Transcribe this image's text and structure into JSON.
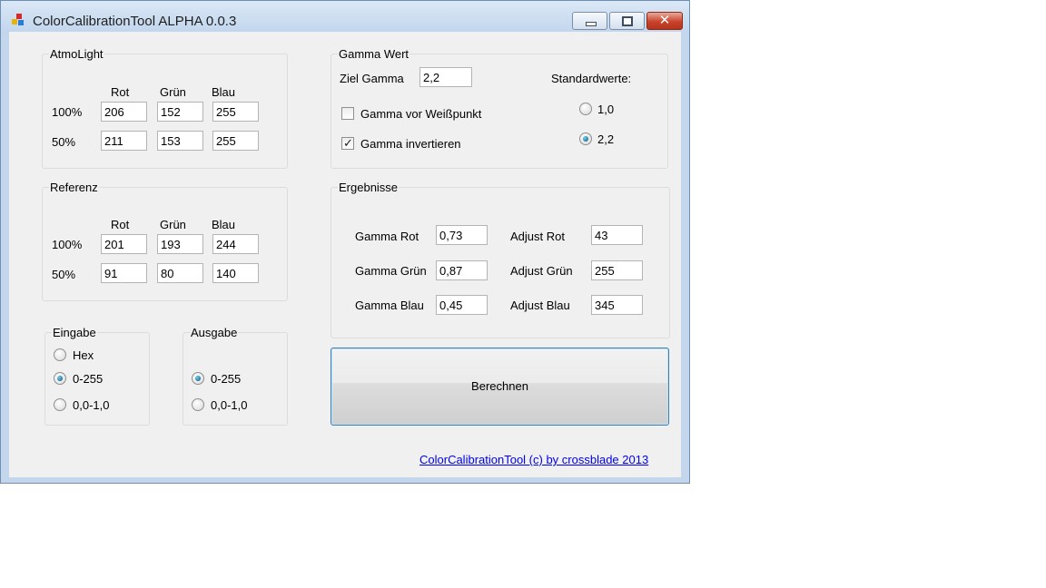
{
  "window": {
    "title": "ColorCalibrationTool ALPHA 0.0.3",
    "controls": [
      "minimize",
      "maximize",
      "close"
    ]
  },
  "atmolight": {
    "title": "AtmoLight",
    "columns": [
      "Rot",
      "Grün",
      "Blau"
    ],
    "rows": [
      {
        "label": "100%",
        "values": [
          "206",
          "152",
          "255"
        ]
      },
      {
        "label": "50%",
        "values": [
          "211",
          "153",
          "255"
        ]
      }
    ]
  },
  "referenz": {
    "title": "Referenz",
    "columns": [
      "Rot",
      "Grün",
      "Blau"
    ],
    "rows": [
      {
        "label": "100%",
        "values": [
          "201",
          "193",
          "244"
        ]
      },
      {
        "label": "50%",
        "values": [
          "91",
          "80",
          "140"
        ]
      }
    ]
  },
  "eingabe": {
    "title": "Eingabe",
    "options": [
      "Hex",
      "0-255",
      "0,0-1,0"
    ],
    "selected": "0-255"
  },
  "ausgabe": {
    "title": "Ausgabe",
    "options": [
      "0-255",
      "0,0-1,0"
    ],
    "selected": "0-255"
  },
  "gamma": {
    "title": "Gamma Wert",
    "ziel_label": "Ziel Gamma",
    "ziel_value": "2,2",
    "standard_label": "Standardwerte:",
    "standard_options": [
      "1,0",
      "2,2"
    ],
    "standard_selected": "2,2",
    "check_vor_weisspunkt": {
      "label": "Gamma vor Weißpunkt",
      "checked": false
    },
    "check_invertieren": {
      "label": "Gamma invertieren",
      "checked": true
    }
  },
  "ergebnisse": {
    "title": "Ergebnisse",
    "gamma_rot_label": "Gamma Rot",
    "gamma_rot": "0,73",
    "gamma_gruen_label": "Gamma Grün",
    "gamma_gruen": "0,87",
    "gamma_blau_label": "Gamma Blau",
    "gamma_blau": "0,45",
    "adjust_rot_label": "Adjust Rot",
    "adjust_rot": "43",
    "adjust_gruen_label": "Adjust Grün",
    "adjust_gruen": "255",
    "adjust_blau_label": "Adjust Blau",
    "adjust_blau": "345"
  },
  "buttons": {
    "berechnen": "Berechnen"
  },
  "footer": {
    "link": "ColorCalibrationTool (c) by crossblade 2013"
  }
}
